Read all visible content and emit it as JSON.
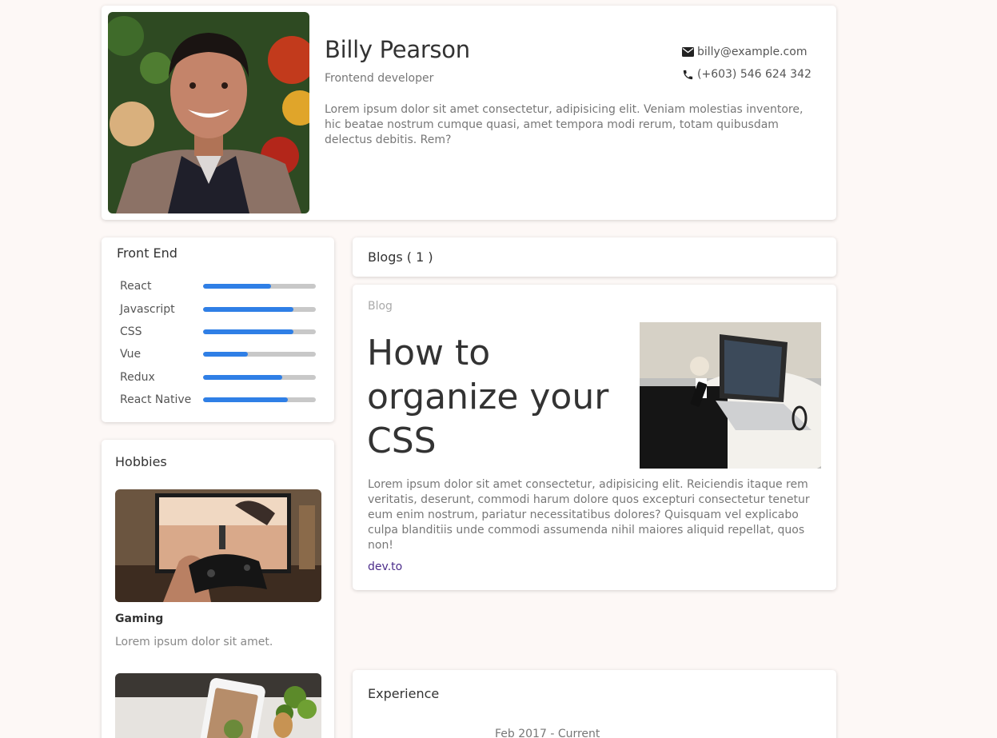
{
  "profile": {
    "name": "Billy Pearson",
    "role": "Frontend developer",
    "bio": "Lorem ipsum dolor sit amet consectetur, adipisicing elit. Veniam molestias inventore, hic beatae nostrum cumque quasi, amet tempora modi rerum, totam quibusdam delectus debitis. Rem?",
    "email": "billy@example.com",
    "phone": "(+603) 546 624 342",
    "email_icon": "envelope-icon",
    "phone_icon": "phone-icon"
  },
  "skills": {
    "title": "Front End",
    "accent": "#2f7fe6",
    "items": [
      {
        "name": "React",
        "level": 0.6
      },
      {
        "name": "Javascript",
        "level": 0.8
      },
      {
        "name": "CSS",
        "level": 0.8
      },
      {
        "name": "Vue",
        "level": 0.4
      },
      {
        "name": "Redux",
        "level": 0.7
      },
      {
        "name": "React Native",
        "level": 0.75
      }
    ]
  },
  "hobbies": {
    "title": "Hobbies",
    "items": [
      {
        "title": "Gaming",
        "desc": "Lorem ipsum dolor sit amet."
      }
    ]
  },
  "blogs": {
    "header": "Blogs ( 1 )",
    "post": {
      "category": "Blog",
      "title": "How to organize your CSS",
      "text": "Lorem ipsum dolor sit amet consectetur, adipisicing elit. Reiciendis itaque rem veritatis, deserunt, commodi harum dolore quos excepturi consectetur tenetur eum enim nostrum, pariatur necessitatibus dolores? Quisquam vel explicabo culpa blanditiis unde commodi assumenda nihil maiores aliquid repellat, quos non!",
      "link": "dev.to"
    }
  },
  "experience": {
    "title": "Experience",
    "date": "Feb 2017 - Current"
  }
}
